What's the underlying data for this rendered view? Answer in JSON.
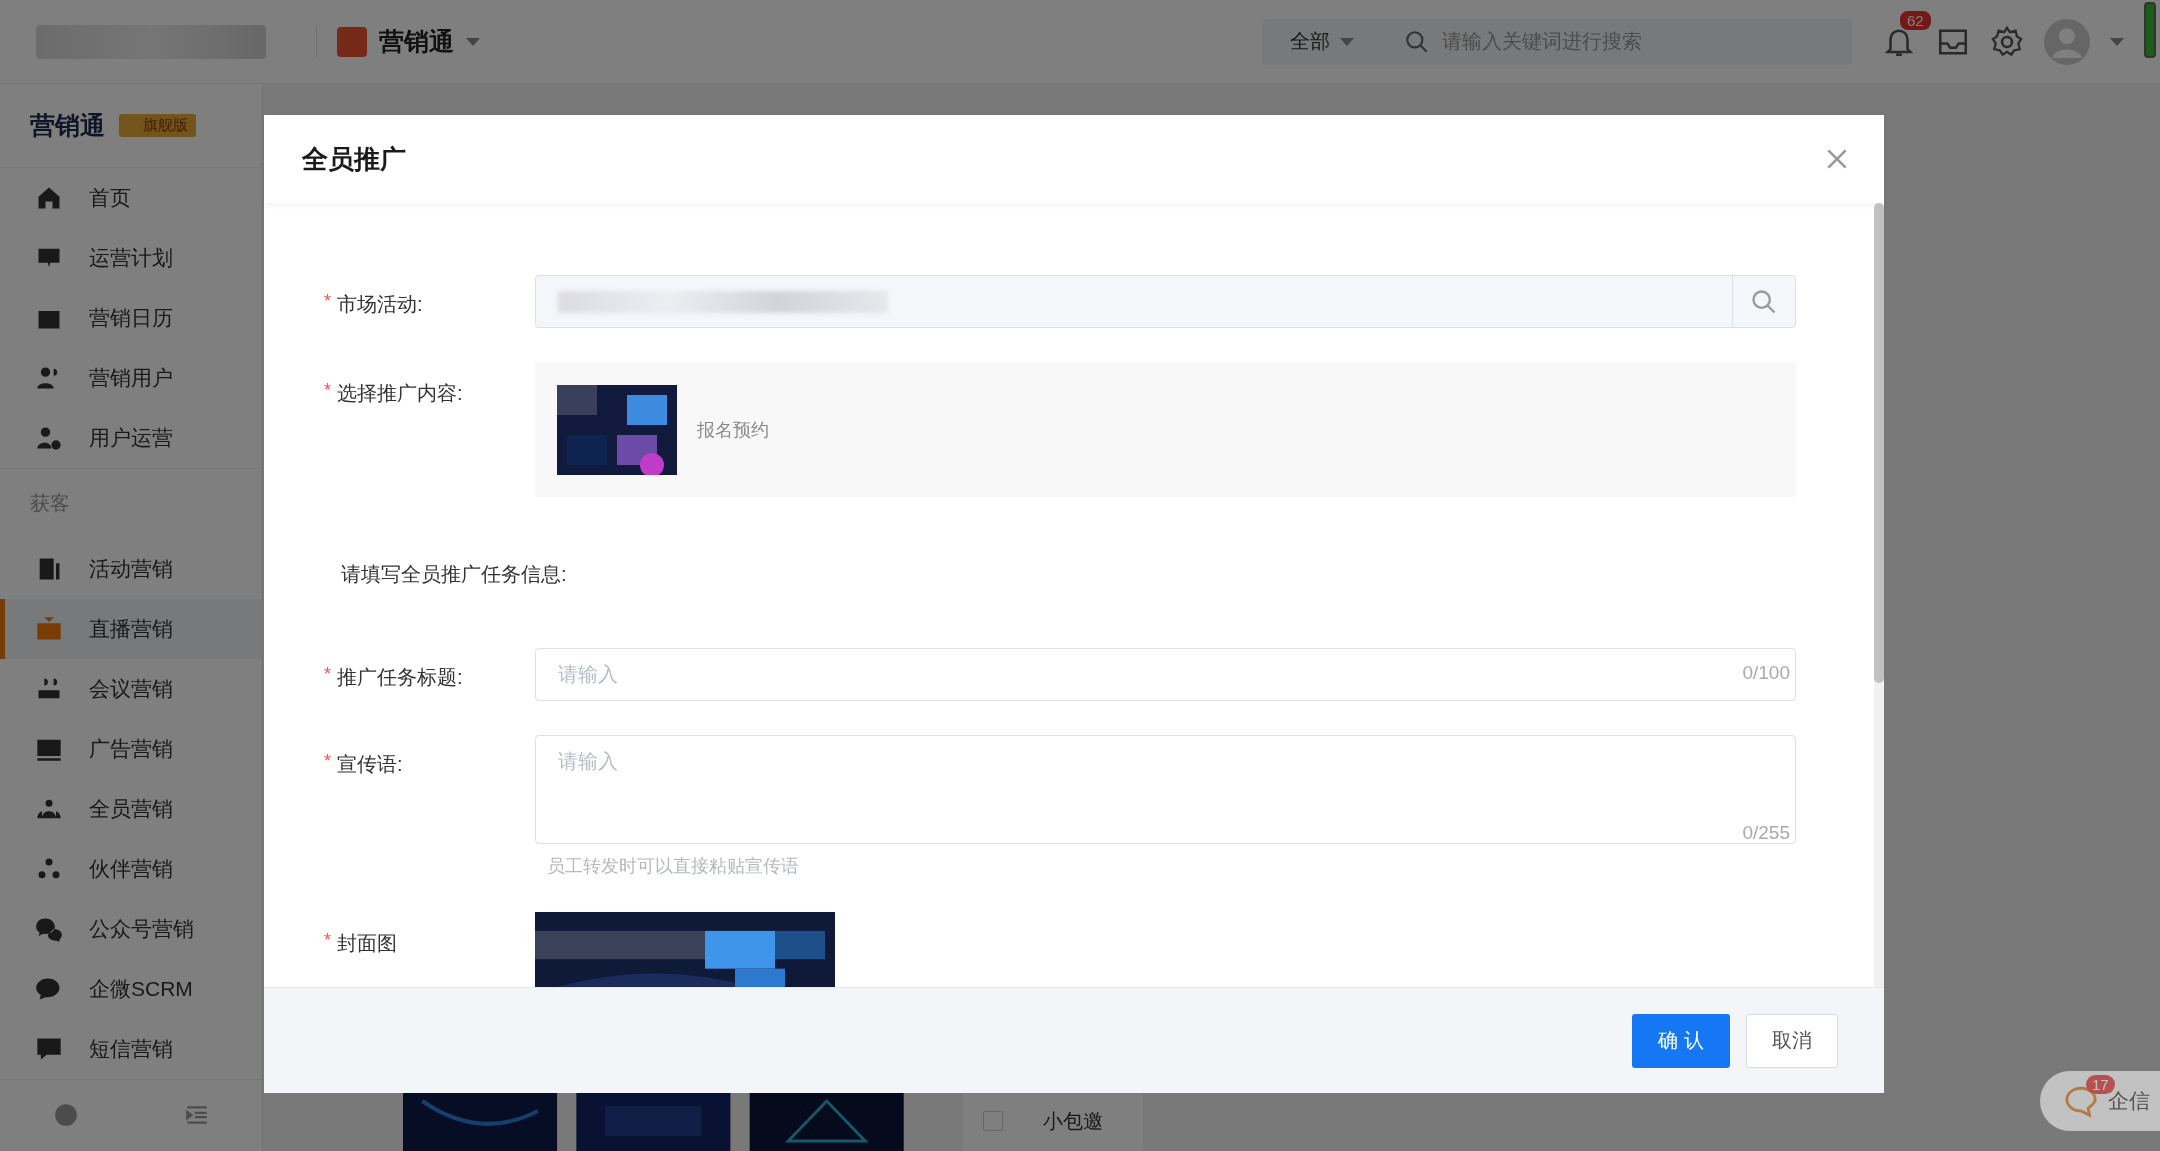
{
  "top_bar": {
    "app_name": "营销通",
    "search_scope": "全部",
    "search_placeholder": "请输入关键词进行搜索",
    "notification_count": "62"
  },
  "sidebar": {
    "title": "营销通",
    "edition": "旗舰版",
    "groups": [
      {
        "items": [
          {
            "label": "首页",
            "selected": false
          },
          {
            "label": "运营计划",
            "selected": false
          },
          {
            "label": "营销日历",
            "selected": false
          },
          {
            "label": "营销用户",
            "selected": false
          },
          {
            "label": "用户运营",
            "selected": false
          }
        ]
      },
      {
        "heading": "获客",
        "items": [
          {
            "label": "活动营销",
            "selected": false
          },
          {
            "label": "直播营销",
            "selected": true
          },
          {
            "label": "会议营销",
            "selected": false
          },
          {
            "label": "广告营销",
            "selected": false
          },
          {
            "label": "全员营销",
            "selected": false
          },
          {
            "label": "伙伴营销",
            "selected": false
          },
          {
            "label": "公众号营销",
            "selected": false
          },
          {
            "label": "企微SCRM",
            "selected": false
          },
          {
            "label": "短信营销",
            "selected": false
          }
        ]
      }
    ]
  },
  "background": {
    "list_item": "小包邀",
    "list_item_checked": false,
    "chat": {
      "label": "企信",
      "badge": "17"
    }
  },
  "modal": {
    "title": "全员推广",
    "fields": [
      {
        "kind": "search",
        "required_mark": "*",
        "label": "市场活动:"
      },
      {
        "kind": "content",
        "required_mark": "*",
        "label": "选择推广内容:",
        "content_title": "报名预约"
      },
      {
        "kind": "heading",
        "label": "请填写全员推广任务信息:"
      },
      {
        "kind": "input",
        "required_mark": "*",
        "label": "推广任务标题:",
        "placeholder": "请输入",
        "count": "0/100"
      },
      {
        "kind": "textarea",
        "required_mark": "*",
        "label": "宣传语:",
        "placeholder": "请输入",
        "count": "0/255",
        "hint": "员工转发时可以直接粘贴宣传语"
      },
      {
        "required_mark": "*",
        "label": "封面图"
      }
    ],
    "buttons": [
      {
        "label": "确 认",
        "kind": "primary"
      },
      {
        "label": "取消",
        "kind": "default"
      }
    ]
  }
}
